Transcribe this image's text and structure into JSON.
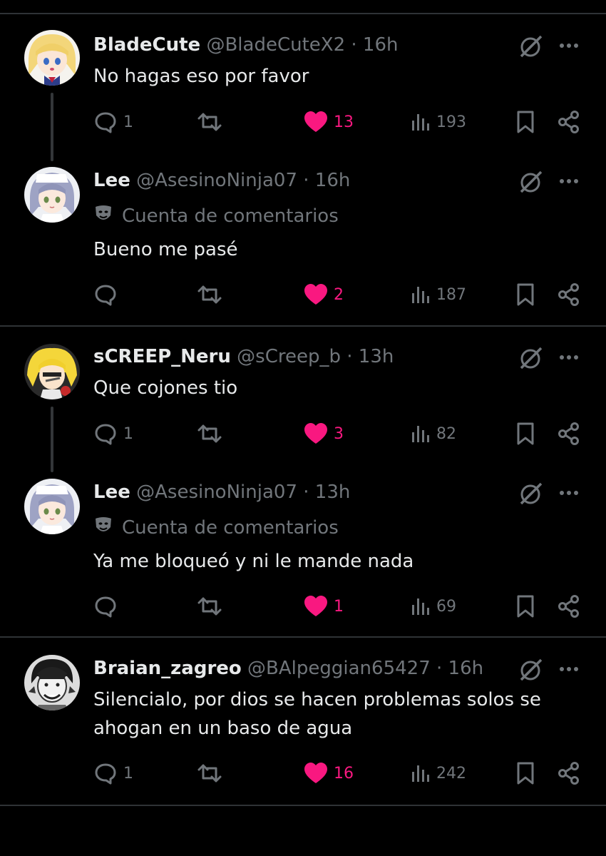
{
  "colors": {
    "background": "#000000",
    "divider": "#2f3336",
    "text": "#e7e9ea",
    "muted": "#71767b",
    "like": "#f91880"
  },
  "posts": [
    {
      "name": "BladeCute",
      "handle": "@BladeCuteX2",
      "time": "16h",
      "badge": "",
      "text": "No hagas eso por favor",
      "replies": "1",
      "retweets": "",
      "likes": "13",
      "views": "193",
      "avatar": "blonde-anime-girl-avatar"
    },
    {
      "name": "Lee",
      "handle": "@AsesinoNinja07",
      "time": "16h",
      "badge": "Cuenta de comentarios",
      "text": "Bueno me pasé",
      "replies": "",
      "retweets": "",
      "likes": "2",
      "views": "187",
      "avatar": "silver-hair-anime-avatar"
    },
    {
      "name": "sCREEP_Neru",
      "handle": "@sCreep_b",
      "time": "13h",
      "badge": "",
      "text": "Que cojones tio",
      "replies": "1",
      "retweets": "",
      "likes": "3",
      "views": "82",
      "avatar": "yellow-hair-anime-avatar"
    },
    {
      "name": "Lee",
      "handle": "@AsesinoNinja07",
      "time": "13h",
      "badge": "Cuenta de comentarios",
      "text": "Ya me bloqueó y ni le mande nada",
      "replies": "",
      "retweets": "",
      "likes": "1",
      "views": "69",
      "avatar": "silver-hair-anime-avatar"
    },
    {
      "name": "Braian_zagreo",
      "handle": "@BAlpeggian65427",
      "time": "16h",
      "badge": "",
      "text": "Silencialo, por dios se hacen problemas solos se ahogan en un baso de agua",
      "replies": "1",
      "retweets": "",
      "likes": "16",
      "views": "242",
      "avatar": "manga-guy-avatar"
    }
  ],
  "icons": {
    "reply": "reply-icon",
    "retweet": "retweet-icon",
    "like": "heart-icon",
    "views": "views-icon",
    "bookmark": "bookmark-icon",
    "share": "share-icon",
    "grok": "grok-icon",
    "more": "more-icon",
    "badge": "theater-mask-icon"
  }
}
